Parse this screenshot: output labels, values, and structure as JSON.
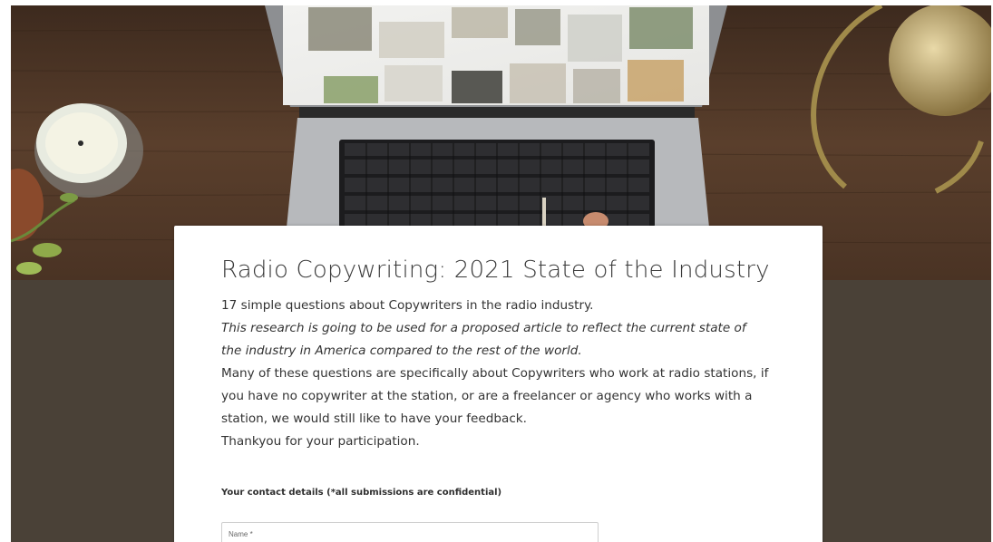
{
  "colors": {
    "hero_wood": "#4a3526",
    "lower_background": "#4a4137",
    "card_background": "#ffffff",
    "title_text": "#3a3a3a",
    "body_text": "#333333"
  },
  "form": {
    "title": "Radio Copywriting: 2021 State of the Industry",
    "description": {
      "line1": "17 simple questions about Copywriters in the radio industry.",
      "line2_italic": "This research is going to be used for a proposed article to reflect the current state of the industry in America compared to the rest of the world.",
      "line3": "Many of these questions are specifically about Copywriters who work at radio stations, if you have no copywriter at the station, or are a freelancer or agency who works with a station, we would still like to have your feedback.",
      "line4": "Thankyou for your participation."
    },
    "section_label": "Your contact details (*all submissions are confidential)",
    "fields": {
      "name_label": "Name *"
    }
  },
  "hero": {
    "icons": [
      "laptop-icon",
      "candle-icon",
      "lamp-icon",
      "plant-icon"
    ]
  }
}
